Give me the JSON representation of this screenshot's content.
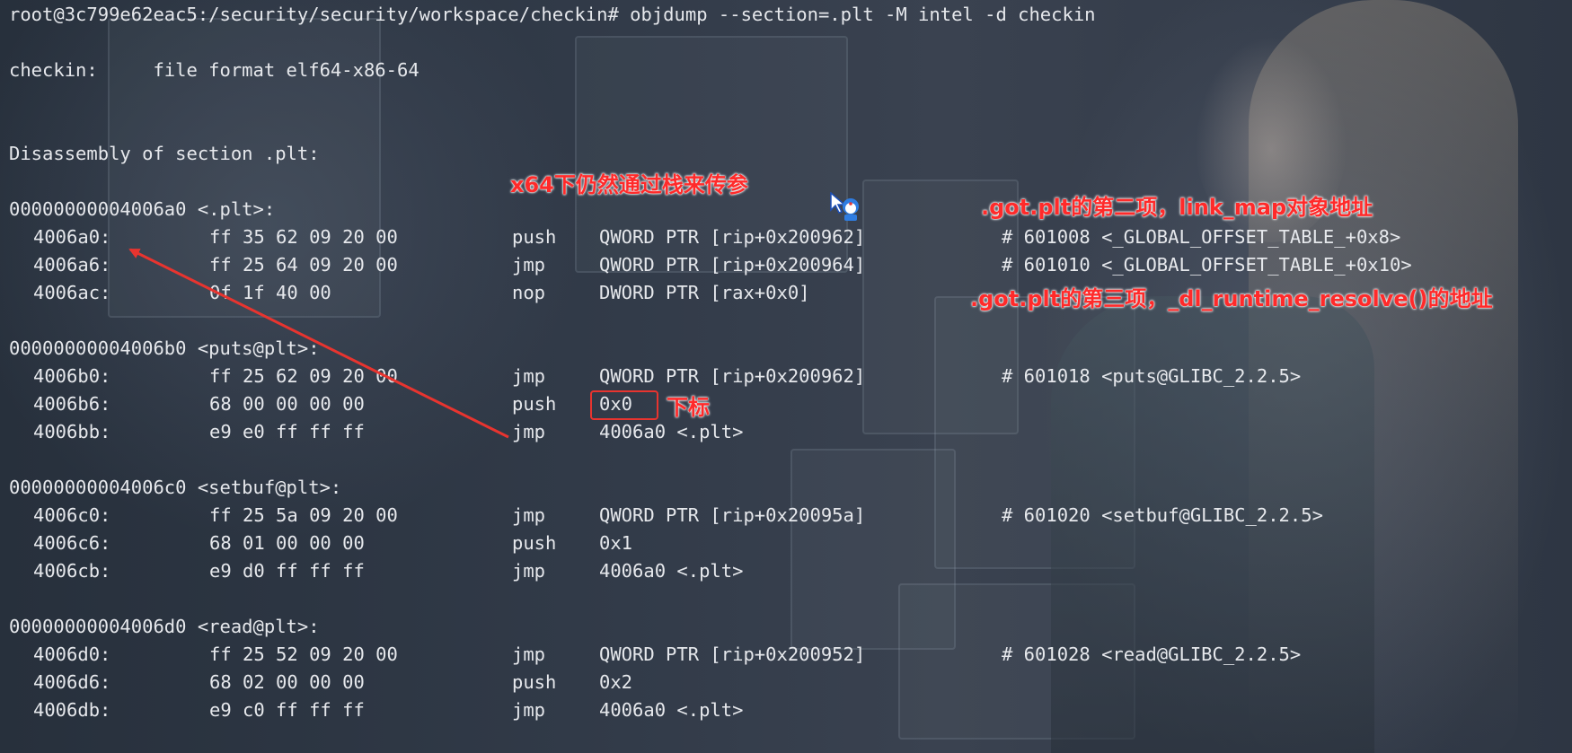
{
  "terminal": {
    "prompt": "root@3c799e62eac5:/security/security/workspace/checkin# objdump --section=.plt -M intel -d checkin",
    "file_format_line": "checkin:     file format elf64-x86-64",
    "section_header": "Disassembly of section .plt:",
    "blocks": [
      {
        "label": "00000000004006a0 <.plt>:",
        "rows": [
          {
            "addr": "4006a0:",
            "bytes": "ff 35 62 09 20 00",
            "mnemonic": "push",
            "operand": "QWORD PTR [rip+0x200962]",
            "comment": "# 601008 <_GLOBAL_OFFSET_TABLE_+0x8>"
          },
          {
            "addr": "4006a6:",
            "bytes": "ff 25 64 09 20 00",
            "mnemonic": "jmp",
            "operand": "QWORD PTR [rip+0x200964]",
            "comment": "# 601010 <_GLOBAL_OFFSET_TABLE_+0x10>"
          },
          {
            "addr": "4006ac:",
            "bytes": "0f 1f 40 00",
            "mnemonic": "nop",
            "operand": "DWORD PTR [rax+0x0]",
            "comment": ""
          }
        ]
      },
      {
        "label": "00000000004006b0 <puts@plt>:",
        "rows": [
          {
            "addr": "4006b0:",
            "bytes": "ff 25 62 09 20 00",
            "mnemonic": "jmp",
            "operand": "QWORD PTR [rip+0x200962]",
            "comment": "# 601018 <puts@GLIBC_2.2.5>"
          },
          {
            "addr": "4006b6:",
            "bytes": "68 00 00 00 00",
            "mnemonic": "push",
            "operand": "0x0",
            "comment": ""
          },
          {
            "addr": "4006bb:",
            "bytes": "e9 e0 ff ff ff",
            "mnemonic": "jmp",
            "operand": "4006a0 <.plt>",
            "comment": ""
          }
        ]
      },
      {
        "label": "00000000004006c0 <setbuf@plt>:",
        "rows": [
          {
            "addr": "4006c0:",
            "bytes": "ff 25 5a 09 20 00",
            "mnemonic": "jmp",
            "operand": "QWORD PTR [rip+0x20095a]",
            "comment": "# 601020 <setbuf@GLIBC_2.2.5>"
          },
          {
            "addr": "4006c6:",
            "bytes": "68 01 00 00 00",
            "mnemonic": "push",
            "operand": "0x1",
            "comment": ""
          },
          {
            "addr": "4006cb:",
            "bytes": "e9 d0 ff ff ff",
            "mnemonic": "jmp",
            "operand": "4006a0 <.plt>",
            "comment": ""
          }
        ]
      },
      {
        "label": "00000000004006d0 <read@plt>:",
        "rows": [
          {
            "addr": "4006d0:",
            "bytes": "ff 25 52 09 20 00",
            "mnemonic": "jmp",
            "operand": "QWORD PTR [rip+0x200952]",
            "comment": "# 601028 <read@GLIBC_2.2.5>"
          },
          {
            "addr": "4006d6:",
            "bytes": "68 02 00 00 00",
            "mnemonic": "push",
            "operand": "0x2",
            "comment": ""
          },
          {
            "addr": "4006db:",
            "bytes": "e9 c0 ff ff ff",
            "mnemonic": "jmp",
            "operand": "4006a0 <.plt>",
            "comment": ""
          }
        ]
      }
    ]
  },
  "annotations": {
    "x64_note": "x64下仍然通过栈来传参",
    "got_second": ".got.plt的第二项，link_map对象地址",
    "got_third": ".got.plt的第三项，_dl_runtime_resolve()的地址",
    "index_note": "下标"
  },
  "colors": {
    "text": "#e6e8ec",
    "annotation": "#ff2a2a",
    "arrow": "#e8342f",
    "background": "#2b3340"
  },
  "icons": {
    "cursor": "doraemon-cursor-icon"
  }
}
